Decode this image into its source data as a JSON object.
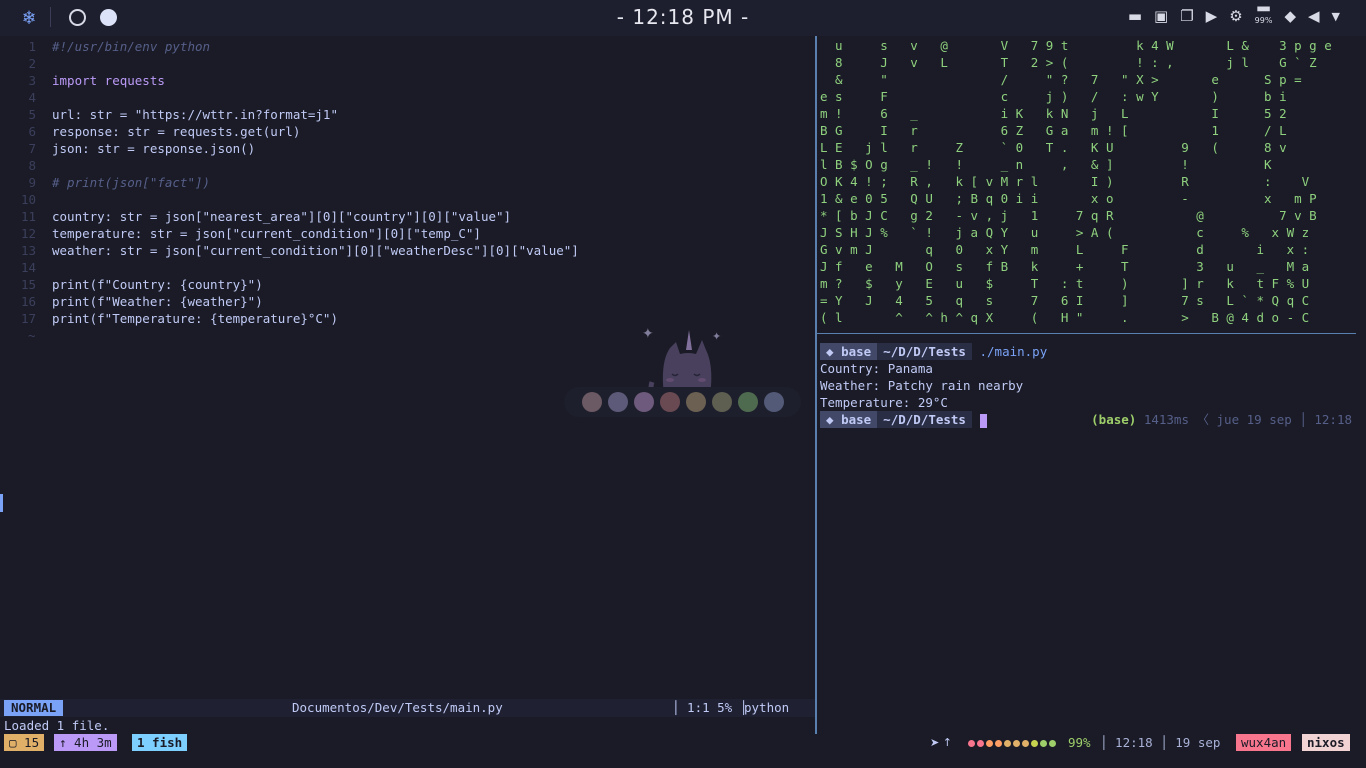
{
  "topbar": {
    "clock": "- 12:18 PM -",
    "battery_pct": "99%"
  },
  "editor": {
    "lines": [
      {
        "n": "1",
        "t": "#!/usr/bin/env python"
      },
      {
        "n": "2",
        "t": ""
      },
      {
        "n": "3",
        "t": "import requests"
      },
      {
        "n": "4",
        "t": ""
      },
      {
        "n": "5",
        "t": "url: str = \"https://wttr.in?format=j1\""
      },
      {
        "n": "6",
        "t": "response: str = requests.get(url)"
      },
      {
        "n": "7",
        "t": "json: str = response.json()"
      },
      {
        "n": "8",
        "t": ""
      },
      {
        "n": "9",
        "t": "# print(json[\"fact\"])"
      },
      {
        "n": "10",
        "t": ""
      },
      {
        "n": "11",
        "t": "country: str = json[\"nearest_area\"][0][\"country\"][0][\"value\"]"
      },
      {
        "n": "12",
        "t": "temperature: str = json[\"current_condition\"][0][\"temp_C\"]"
      },
      {
        "n": "13",
        "t": "weather: str = json[\"current_condition\"][0][\"weatherDesc\"][0][\"value\"]"
      },
      {
        "n": "14",
        "t": ""
      },
      {
        "n": "15",
        "t": "print(f\"Country: {country}\")"
      },
      {
        "n": "16",
        "t": "print(f\"Weather: {weather}\")"
      },
      {
        "n": "17",
        "t": "print(f\"Temperature: {temperature}°C\")"
      }
    ],
    "tilde": "~",
    "mode": "NORMAL",
    "filename": "Documentos/Dev/Tests/main.py",
    "position": "│ 1:1 5% │",
    "filetype": "python",
    "message": "Loaded 1 file."
  },
  "matrix": [
    "  u     s   v   @       V   7 9 t         k 4 W       L &    3 p g e",
    "  8     J   v   L       T   2 > (         ! : ,       j l    G ` Z",
    "  &     \"               /     \" ?   7   \" X >       e      S p =",
    "e s     F               c     j )   /   : w Y       )      b i",
    "m !     6   _           i K   k N   j   L           I      5 2",
    "B G     I   r           6 Z   G a   m ! [           1      / L",
    "L E   j l   r     Z     ` 0   T .   K U         9   (      8 v",
    "l B $ O g   _ !   !     _ n     ,   & ]         !          K",
    "O K 4 ! ;   R ,   k [ v M r l       I )         R          :    V",
    "1 & e 0 5   Q U   ; B q 0 i i       x o         -          x   m P",
    "* [ b J C   g 2   - v , j   1     7 q R           @          7 v B",
    "J S H J %   ` !   j a Q Y   u     > A (           c     %   x W z",
    "G v m J       q   0   x Y   m     L     F         d       i   x :",
    "J f   e   M   O   s   f B   k     +     T         3   u   _   M a",
    "m ?   $   y   E   u   $     T   : t     )       ] r   k   t F % U",
    "= Y   J   4   5   q   s     7   6 I     ]       7 s   L ` * Q q C",
    "( l       ^   ^ h ^ q X     (   H \"     .       >   B @ 4 d o - C"
  ],
  "terminal": {
    "env": "base",
    "path": "~/D/D/Tests",
    "command": "./main.py",
    "output": [
      "Country: Panama",
      "Weather: Patchy rain nearby",
      "Temperature: 29°C"
    ],
    "right_env": "(base)",
    "right_info": "1413ms 〈 jue 19 sep │ 12:18"
  },
  "bottombar": {
    "ws": "▢ 15",
    "uptime": "↑ 4h 3m",
    "fish": "1 fish",
    "battery": "99%",
    "time": "│ 12:18 │ 19 sep",
    "user": "wux4an",
    "host": "nixos"
  },
  "colors": {
    "accent": "#7aa2f7",
    "matrix": "#8fd17e",
    "background": "#1a1b26"
  },
  "palette": [
    "#6b5963",
    "#5c5a78",
    "#6e5a7c",
    "#6a4a52",
    "#6b6052",
    "#5e5f50",
    "#4f6b4f",
    "#525a78"
  ]
}
